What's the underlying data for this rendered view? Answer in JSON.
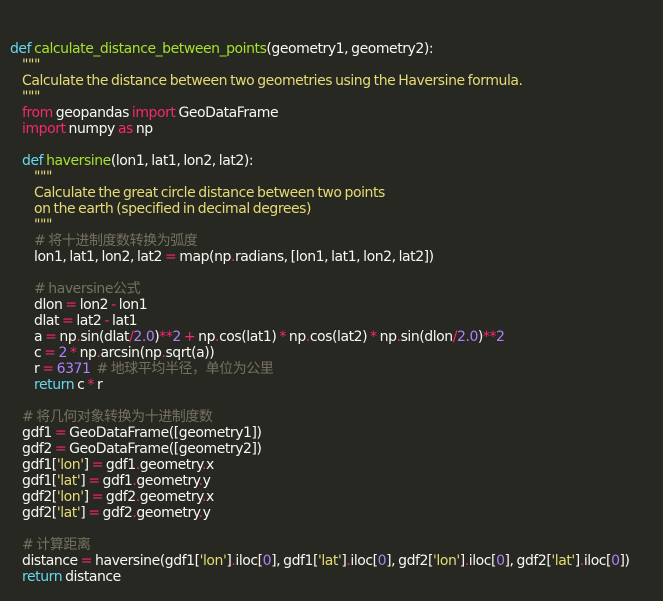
{
  "colors": {
    "background": "#272822",
    "keyword": "#66d9ef",
    "function_name": "#a6e22e",
    "string": "#e6db74",
    "number": "#ae81ff",
    "operator": "#f92672",
    "comment": "#75715e",
    "text": "#f8f8f2"
  },
  "code_lines": [
    [
      [
        "kw",
        "def "
      ],
      [
        "fn",
        "calculate_distance_between_points"
      ],
      [
        "txt",
        "(geometry1, geometry2):"
      ]
    ],
    [
      [
        "txt",
        "    "
      ],
      [
        "str",
        "\"\"\""
      ]
    ],
    [
      [
        "txt",
        "    "
      ],
      [
        "str",
        "Calculate the distance between two geometries using the Haversine formula."
      ]
    ],
    [
      [
        "txt",
        "    "
      ],
      [
        "str",
        "\"\"\""
      ]
    ],
    [
      [
        "txt",
        "    "
      ],
      [
        "imp",
        "from"
      ],
      [
        "txt",
        " geopandas "
      ],
      [
        "imp",
        "import"
      ],
      [
        "txt",
        " GeoDataFrame"
      ]
    ],
    [
      [
        "txt",
        "    "
      ],
      [
        "imp",
        "import"
      ],
      [
        "txt",
        " numpy "
      ],
      [
        "imp",
        "as"
      ],
      [
        "txt",
        " np"
      ]
    ],
    [
      [
        "txt",
        ""
      ]
    ],
    [
      [
        "txt",
        "    "
      ],
      [
        "kw",
        "def "
      ],
      [
        "fn",
        "haversine"
      ],
      [
        "txt",
        "(lon1, lat1, lon2, lat2):"
      ]
    ],
    [
      [
        "txt",
        "        "
      ],
      [
        "str",
        "\"\"\""
      ]
    ],
    [
      [
        "txt",
        "        "
      ],
      [
        "str",
        "Calculate the great circle distance between two points"
      ]
    ],
    [
      [
        "txt",
        "        "
      ],
      [
        "str",
        "on the earth (specified in decimal degrees)"
      ]
    ],
    [
      [
        "txt",
        "        "
      ],
      [
        "str",
        "\"\"\""
      ]
    ],
    [
      [
        "txt",
        "        "
      ],
      [
        "cmt",
        "# 将十进制度数转换为弧度"
      ]
    ],
    [
      [
        "txt",
        "        lon1, lat1, lon2, lat2 "
      ],
      [
        "op",
        "="
      ],
      [
        "txt",
        " map(np"
      ],
      [
        "op",
        "."
      ],
      [
        "txt",
        "radians, [lon1, lat1, lon2, lat2])"
      ]
    ],
    [
      [
        "txt",
        ""
      ]
    ],
    [
      [
        "txt",
        "        "
      ],
      [
        "cmt",
        "# haversine公式"
      ]
    ],
    [
      [
        "txt",
        "        dlon "
      ],
      [
        "op",
        "="
      ],
      [
        "txt",
        " lon2 "
      ],
      [
        "op",
        "-"
      ],
      [
        "txt",
        " lon1"
      ]
    ],
    [
      [
        "txt",
        "        dlat "
      ],
      [
        "op",
        "="
      ],
      [
        "txt",
        " lat2 "
      ],
      [
        "op",
        "-"
      ],
      [
        "txt",
        " lat1"
      ]
    ],
    [
      [
        "txt",
        "        a "
      ],
      [
        "op",
        "="
      ],
      [
        "txt",
        " np"
      ],
      [
        "op",
        "."
      ],
      [
        "txt",
        "sin(dlat"
      ],
      [
        "op",
        "/"
      ],
      [
        "num",
        "2.0"
      ],
      [
        "txt",
        ")"
      ],
      [
        "op",
        "**"
      ],
      [
        "num",
        "2"
      ],
      [
        "txt",
        " "
      ],
      [
        "op",
        "+"
      ],
      [
        "txt",
        " np"
      ],
      [
        "op",
        "."
      ],
      [
        "txt",
        "cos(lat1) "
      ],
      [
        "op",
        "*"
      ],
      [
        "txt",
        " np"
      ],
      [
        "op",
        "."
      ],
      [
        "txt",
        "cos(lat2) "
      ],
      [
        "op",
        "*"
      ],
      [
        "txt",
        " np"
      ],
      [
        "op",
        "."
      ],
      [
        "txt",
        "sin(dlon"
      ],
      [
        "op",
        "/"
      ],
      [
        "num",
        "2.0"
      ],
      [
        "txt",
        ")"
      ],
      [
        "op",
        "**"
      ],
      [
        "num",
        "2"
      ]
    ],
    [
      [
        "txt",
        "        c "
      ],
      [
        "op",
        "="
      ],
      [
        "txt",
        " "
      ],
      [
        "num",
        "2"
      ],
      [
        "txt",
        " "
      ],
      [
        "op",
        "*"
      ],
      [
        "txt",
        " np"
      ],
      [
        "op",
        "."
      ],
      [
        "txt",
        "arcsin(np"
      ],
      [
        "op",
        "."
      ],
      [
        "txt",
        "sqrt(a))"
      ]
    ],
    [
      [
        "txt",
        "        r "
      ],
      [
        "op",
        "="
      ],
      [
        "txt",
        " "
      ],
      [
        "num",
        "6371"
      ],
      [
        "txt",
        "  "
      ],
      [
        "cmt",
        "# 地球平均半径，单位为公里"
      ]
    ],
    [
      [
        "txt",
        "        "
      ],
      [
        "kw",
        "return"
      ],
      [
        "txt",
        " c "
      ],
      [
        "op",
        "*"
      ],
      [
        "txt",
        " r"
      ]
    ],
    [
      [
        "txt",
        ""
      ]
    ],
    [
      [
        "txt",
        "    "
      ],
      [
        "cmt",
        "# 将几何对象转换为十进制度数"
      ]
    ],
    [
      [
        "txt",
        "    gdf1 "
      ],
      [
        "op",
        "="
      ],
      [
        "txt",
        " GeoDataFrame([geometry1])"
      ]
    ],
    [
      [
        "txt",
        "    gdf2 "
      ],
      [
        "op",
        "="
      ],
      [
        "txt",
        " GeoDataFrame([geometry2])"
      ]
    ],
    [
      [
        "txt",
        "    gdf1["
      ],
      [
        "str",
        "'lon'"
      ],
      [
        "txt",
        "] "
      ],
      [
        "op",
        "="
      ],
      [
        "txt",
        " gdf1"
      ],
      [
        "op",
        "."
      ],
      [
        "txt",
        "geometry"
      ],
      [
        "op",
        "."
      ],
      [
        "txt",
        "x"
      ]
    ],
    [
      [
        "txt",
        "    gdf1["
      ],
      [
        "str",
        "'lat'"
      ],
      [
        "txt",
        "] "
      ],
      [
        "op",
        "="
      ],
      [
        "txt",
        " gdf1"
      ],
      [
        "op",
        "."
      ],
      [
        "txt",
        "geometry"
      ],
      [
        "op",
        "."
      ],
      [
        "txt",
        "y"
      ]
    ],
    [
      [
        "txt",
        "    gdf2["
      ],
      [
        "str",
        "'lon'"
      ],
      [
        "txt",
        "] "
      ],
      [
        "op",
        "="
      ],
      [
        "txt",
        " gdf2"
      ],
      [
        "op",
        "."
      ],
      [
        "txt",
        "geometry"
      ],
      [
        "op",
        "."
      ],
      [
        "txt",
        "x"
      ]
    ],
    [
      [
        "txt",
        "    gdf2["
      ],
      [
        "str",
        "'lat'"
      ],
      [
        "txt",
        "] "
      ],
      [
        "op",
        "="
      ],
      [
        "txt",
        " gdf2"
      ],
      [
        "op",
        "."
      ],
      [
        "txt",
        "geometry"
      ],
      [
        "op",
        "."
      ],
      [
        "txt",
        "y"
      ]
    ],
    [
      [
        "txt",
        ""
      ]
    ],
    [
      [
        "txt",
        "    "
      ],
      [
        "cmt",
        "# 计算距离"
      ]
    ],
    [
      [
        "txt",
        "    distance "
      ],
      [
        "op",
        "="
      ],
      [
        "txt",
        " haversine(gdf1["
      ],
      [
        "str",
        "'lon'"
      ],
      [
        "txt",
        "]"
      ],
      [
        "op",
        "."
      ],
      [
        "txt",
        "iloc["
      ],
      [
        "num",
        "0"
      ],
      [
        "txt",
        "], gdf1["
      ],
      [
        "str",
        "'lat'"
      ],
      [
        "txt",
        "]"
      ],
      [
        "op",
        "."
      ],
      [
        "txt",
        "iloc["
      ],
      [
        "num",
        "0"
      ],
      [
        "txt",
        "], gdf2["
      ],
      [
        "str",
        "'lon'"
      ],
      [
        "txt",
        "]"
      ],
      [
        "op",
        "."
      ],
      [
        "txt",
        "iloc["
      ],
      [
        "num",
        "0"
      ],
      [
        "txt",
        "], gdf2["
      ],
      [
        "str",
        "'lat'"
      ],
      [
        "txt",
        "]"
      ],
      [
        "op",
        "."
      ],
      [
        "txt",
        "iloc["
      ],
      [
        "num",
        "0"
      ],
      [
        "txt",
        "])"
      ]
    ],
    [
      [
        "txt",
        "    "
      ],
      [
        "kw",
        "return"
      ],
      [
        "txt",
        " distance"
      ]
    ]
  ]
}
